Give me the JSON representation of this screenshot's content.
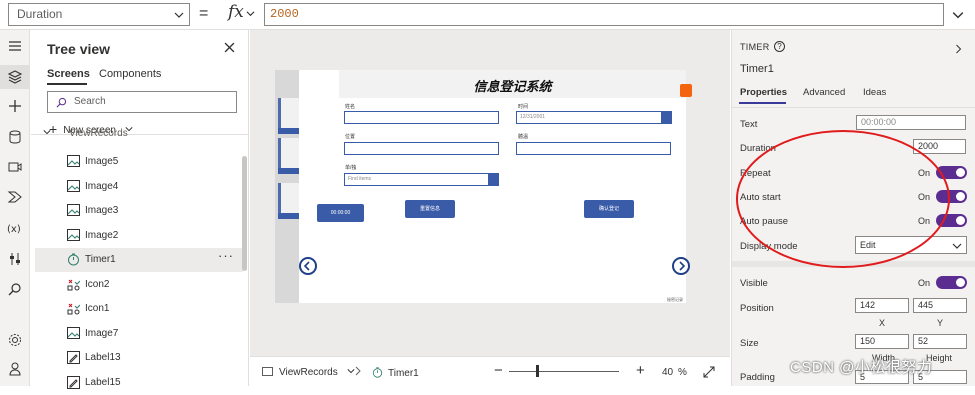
{
  "formula_bar": {
    "property": "Duration",
    "equals": "=",
    "fx": "fx",
    "value": "2000"
  },
  "tree": {
    "title": "Tree view",
    "tabs": [
      "Screens",
      "Components"
    ],
    "search_placeholder": "Search",
    "new_screen": "New screen",
    "items": [
      {
        "label": "ViewRecords",
        "icon": "screen-icon"
      },
      {
        "label": "Image5",
        "icon": "image-icon"
      },
      {
        "label": "Image4",
        "icon": "image-icon"
      },
      {
        "label": "Image3",
        "icon": "image-icon"
      },
      {
        "label": "Image2",
        "icon": "image-icon"
      },
      {
        "label": "Timer1",
        "icon": "timer-icon",
        "selected": true
      },
      {
        "label": "Icon2",
        "icon": "icon-control-icon"
      },
      {
        "label": "Icon1",
        "icon": "icon-control-icon"
      },
      {
        "label": "Image7",
        "icon": "image-icon"
      },
      {
        "label": "Label13",
        "icon": "label-icon"
      },
      {
        "label": "Label15",
        "icon": "label-icon"
      }
    ],
    "more": "···"
  },
  "app": {
    "title": "信息登记系统",
    "fields": {
      "name_label": "姓名",
      "time_label": "时间",
      "location_label": "位置",
      "temp_label": "體溫",
      "unit_label": "单/独",
      "date_value": "12/31/2001",
      "combo_placeholder": "Find items"
    },
    "timer_text": "00:00:00",
    "reset_button": "重置信息",
    "confirm_button": "确认登记",
    "footnote": "秘密记录"
  },
  "bottom_bar": {
    "screen": "ViewRecords",
    "control": "Timer1",
    "zoom_minus": "−",
    "zoom_plus": "+",
    "zoom_value": "40",
    "zoom_unit": "%"
  },
  "properties": {
    "type": "TIMER",
    "name": "Timer1",
    "tabs": [
      "Properties",
      "Advanced",
      "Ideas"
    ],
    "text_label": "Text",
    "text_value": "00:00:00",
    "duration_label": "Duration",
    "duration_value": "2000",
    "repeat_label": "Repeat",
    "repeat_state": "On",
    "autostart_label": "Auto start",
    "autostart_state": "On",
    "autopause_label": "Auto pause",
    "autopause_state": "On",
    "display_mode_label": "Display mode",
    "display_mode_value": "Edit",
    "visible_label": "Visible",
    "visible_state": "On",
    "position_label": "Position",
    "position_x": "142",
    "position_y": "445",
    "x_label": "X",
    "y_label": "Y",
    "size_label": "Size",
    "size_width": "150",
    "size_height": "52",
    "width_label": "Width",
    "height_label": "Height",
    "padding_label": "Padding",
    "padding_a": "5",
    "padding_b": "5"
  },
  "watermark": "CSDN @小松很努力",
  "colors": {
    "accent_purple": "#5c2d91",
    "app_blue": "#3a5ca8",
    "orange": "#f4640f",
    "annotation_red": "#e11b1b"
  }
}
